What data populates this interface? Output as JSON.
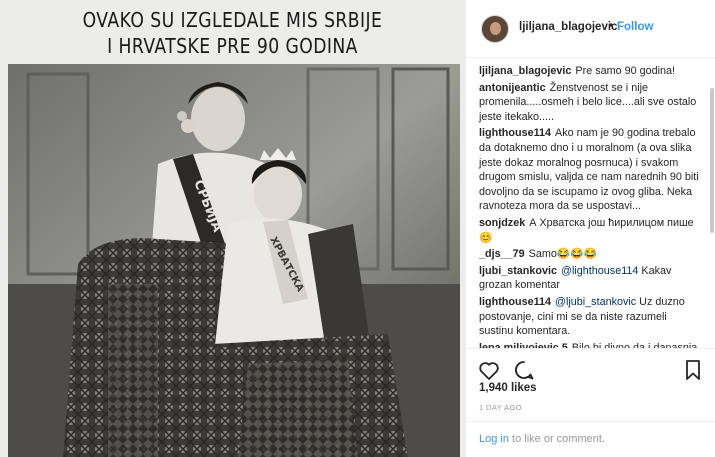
{
  "clipping": {
    "title_line1": "OVAKO SU IZGLEDALE MIS SRBIJE",
    "title_line2": "I HRVATSKE PRE 90 GODINA",
    "sash_left": "СРБИЈА",
    "sash_right": "ХРВАТСКА"
  },
  "header": {
    "username": "ljiljana_blagojevic",
    "separator": "•",
    "follow_label": "Follow"
  },
  "comments": [
    {
      "user": "ljiljana_blagojevic",
      "text": "Pre samo 90 godina!"
    },
    {
      "user": "antonijeantic",
      "text": "Ženstvenost se i nije promenila.....osmeh i belo lice....ali sve ostalo jeste itekako....."
    },
    {
      "user": "lighthouse114",
      "text": "Ako nam je 90 godina trebalo da dotaknemo dno i u moralnom (a ova slika jeste dokaz moralnog posrnuca) i svakom drugom smislu, valjda ce nam narednih 90 biti dovoljno da se iscupamo iz ovog gliba. Neka ravnoteza mora da se uspostavi..."
    },
    {
      "user": "sonjdzek",
      "text": "А Хрватска још ћирилицом пише 😊"
    },
    {
      "user": "_djs__79",
      "text": "Samo😂😂😂"
    },
    {
      "user": "ljubi_stankovic",
      "mention": "@lighthouse114",
      "text": " Kakav grozan komentar"
    },
    {
      "user": "lighthouse114",
      "mention": "@ljubi_stankovic",
      "text": " Uz duzno postovanje, cini mi se da niste razumeli sustinu komentara."
    },
    {
      "user": "lena.milivojevic.5",
      "text": "Bilo bi divno da i danasnja lepota ovako uzqleda ..a ne ovako"
    }
  ],
  "actions": {
    "icons": [
      "heart-icon",
      "comment-icon",
      "bookmark-icon"
    ]
  },
  "post": {
    "likes": "1,940 likes",
    "date": "1 DAY AGO"
  },
  "login_bar": {
    "login_label": "Log in",
    "rest_text": " to like or comment."
  },
  "colors": {
    "link": "#3897f0",
    "mention": "#003569",
    "muted": "#999999",
    "text": "#262626"
  }
}
